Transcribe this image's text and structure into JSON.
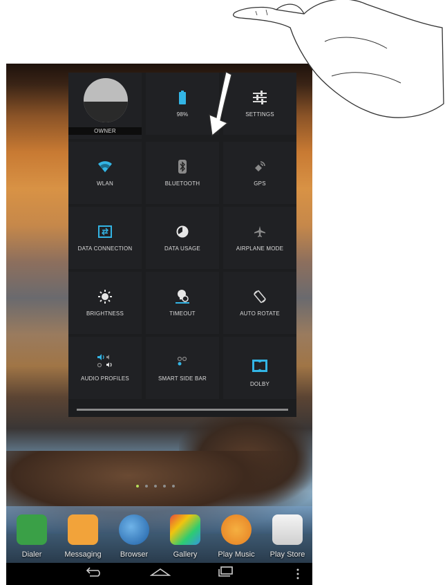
{
  "panel": {
    "tiles": [
      {
        "label": "OWNER",
        "icon": "owner-avatar"
      },
      {
        "label": "98%",
        "icon": "battery-icon"
      },
      {
        "label": "SETTINGS",
        "icon": "settings-sliders-icon"
      },
      {
        "label": "WLAN",
        "icon": "wifi-icon"
      },
      {
        "label": "BLUETOOTH",
        "icon": "bluetooth-icon"
      },
      {
        "label": "GPS",
        "icon": "gps-icon"
      },
      {
        "label": "DATA CONNECTION",
        "icon": "data-connection-icon"
      },
      {
        "label": "DATA USAGE",
        "icon": "data-usage-icon"
      },
      {
        "label": "AIRPLANE MODE",
        "icon": "airplane-icon"
      },
      {
        "label": "BRIGHTNESS",
        "icon": "brightness-icon"
      },
      {
        "label": "TIMEOUT",
        "icon": "timeout-icon"
      },
      {
        "label": "AUTO ROTATE",
        "icon": "auto-rotate-icon"
      },
      {
        "label": "AUDIO PROFILES",
        "icon": "audio-profiles-icon"
      },
      {
        "label": "SMART SIDE BAR",
        "icon": "smart-side-bar-icon"
      },
      {
        "label": "DOLBY",
        "icon": "dolby-icon"
      }
    ]
  },
  "dock": {
    "apps": [
      {
        "label": "Dialer",
        "color": "#3aa047"
      },
      {
        "label": "Messaging",
        "color": "#f2a33a"
      },
      {
        "label": "Browser",
        "color": "#2f7fc7"
      },
      {
        "label": "Gallery",
        "color": "#d9d9d9"
      },
      {
        "label": "Play Music",
        "color": "#f39c12"
      },
      {
        "label": "Play Store",
        "color": "#e8e8e8"
      }
    ]
  },
  "colors": {
    "accent": "#33b5e5",
    "panel_bg": "#1c1d1f",
    "tile_bg": "#202124"
  }
}
